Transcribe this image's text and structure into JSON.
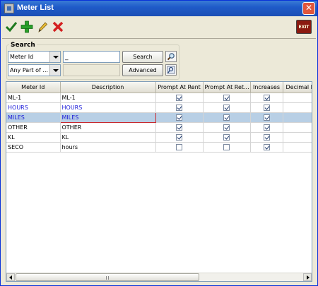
{
  "window": {
    "title": "Meter List",
    "close_label": "✕"
  },
  "toolbar": {
    "buttons": [
      {
        "name": "checkmark-icon",
        "color": "#1f7a1f"
      },
      {
        "name": "plus-icon",
        "color": "#2aa12a"
      },
      {
        "name": "pencil-icon",
        "color": "#d9a521"
      },
      {
        "name": "delete-x-icon",
        "color": "#d42020"
      }
    ],
    "exit_label": "EXIT"
  },
  "search": {
    "legend": "Search",
    "field_select_value": "Meter Id",
    "match_select_value": "Any Part of ...",
    "input_value": "_",
    "search_button": "Search",
    "advanced_button": "Advanced"
  },
  "table": {
    "columns": [
      "Meter Id",
      "Description",
      "Prompt At Rent",
      "Prompt At Ret...",
      "Increases",
      "Decimal P"
    ],
    "rows": [
      {
        "meter_id": "ML-1",
        "description": "ML-1",
        "prompt_rent": true,
        "prompt_return": true,
        "increases": true,
        "style": "normal"
      },
      {
        "meter_id": "HOURS",
        "description": "HOURS",
        "prompt_rent": true,
        "prompt_return": true,
        "increases": true,
        "style": "blue"
      },
      {
        "meter_id": "MILES",
        "description": "MILES",
        "prompt_rent": true,
        "prompt_return": true,
        "increases": true,
        "style": "selected"
      },
      {
        "meter_id": "OTHER",
        "description": "OTHER",
        "prompt_rent": true,
        "prompt_return": true,
        "increases": true,
        "style": "normal"
      },
      {
        "meter_id": "KL",
        "description": "KL",
        "prompt_rent": true,
        "prompt_return": true,
        "increases": true,
        "style": "normal"
      },
      {
        "meter_id": "SECO",
        "description": "hours",
        "prompt_rent": false,
        "prompt_return": false,
        "increases": true,
        "style": "normal"
      }
    ]
  },
  "colors": {
    "title_bar": "#1f5bc9",
    "selected_row": "#b8cfe5",
    "link_text": "#1a1ad8",
    "edit_border": "#c8282e"
  }
}
